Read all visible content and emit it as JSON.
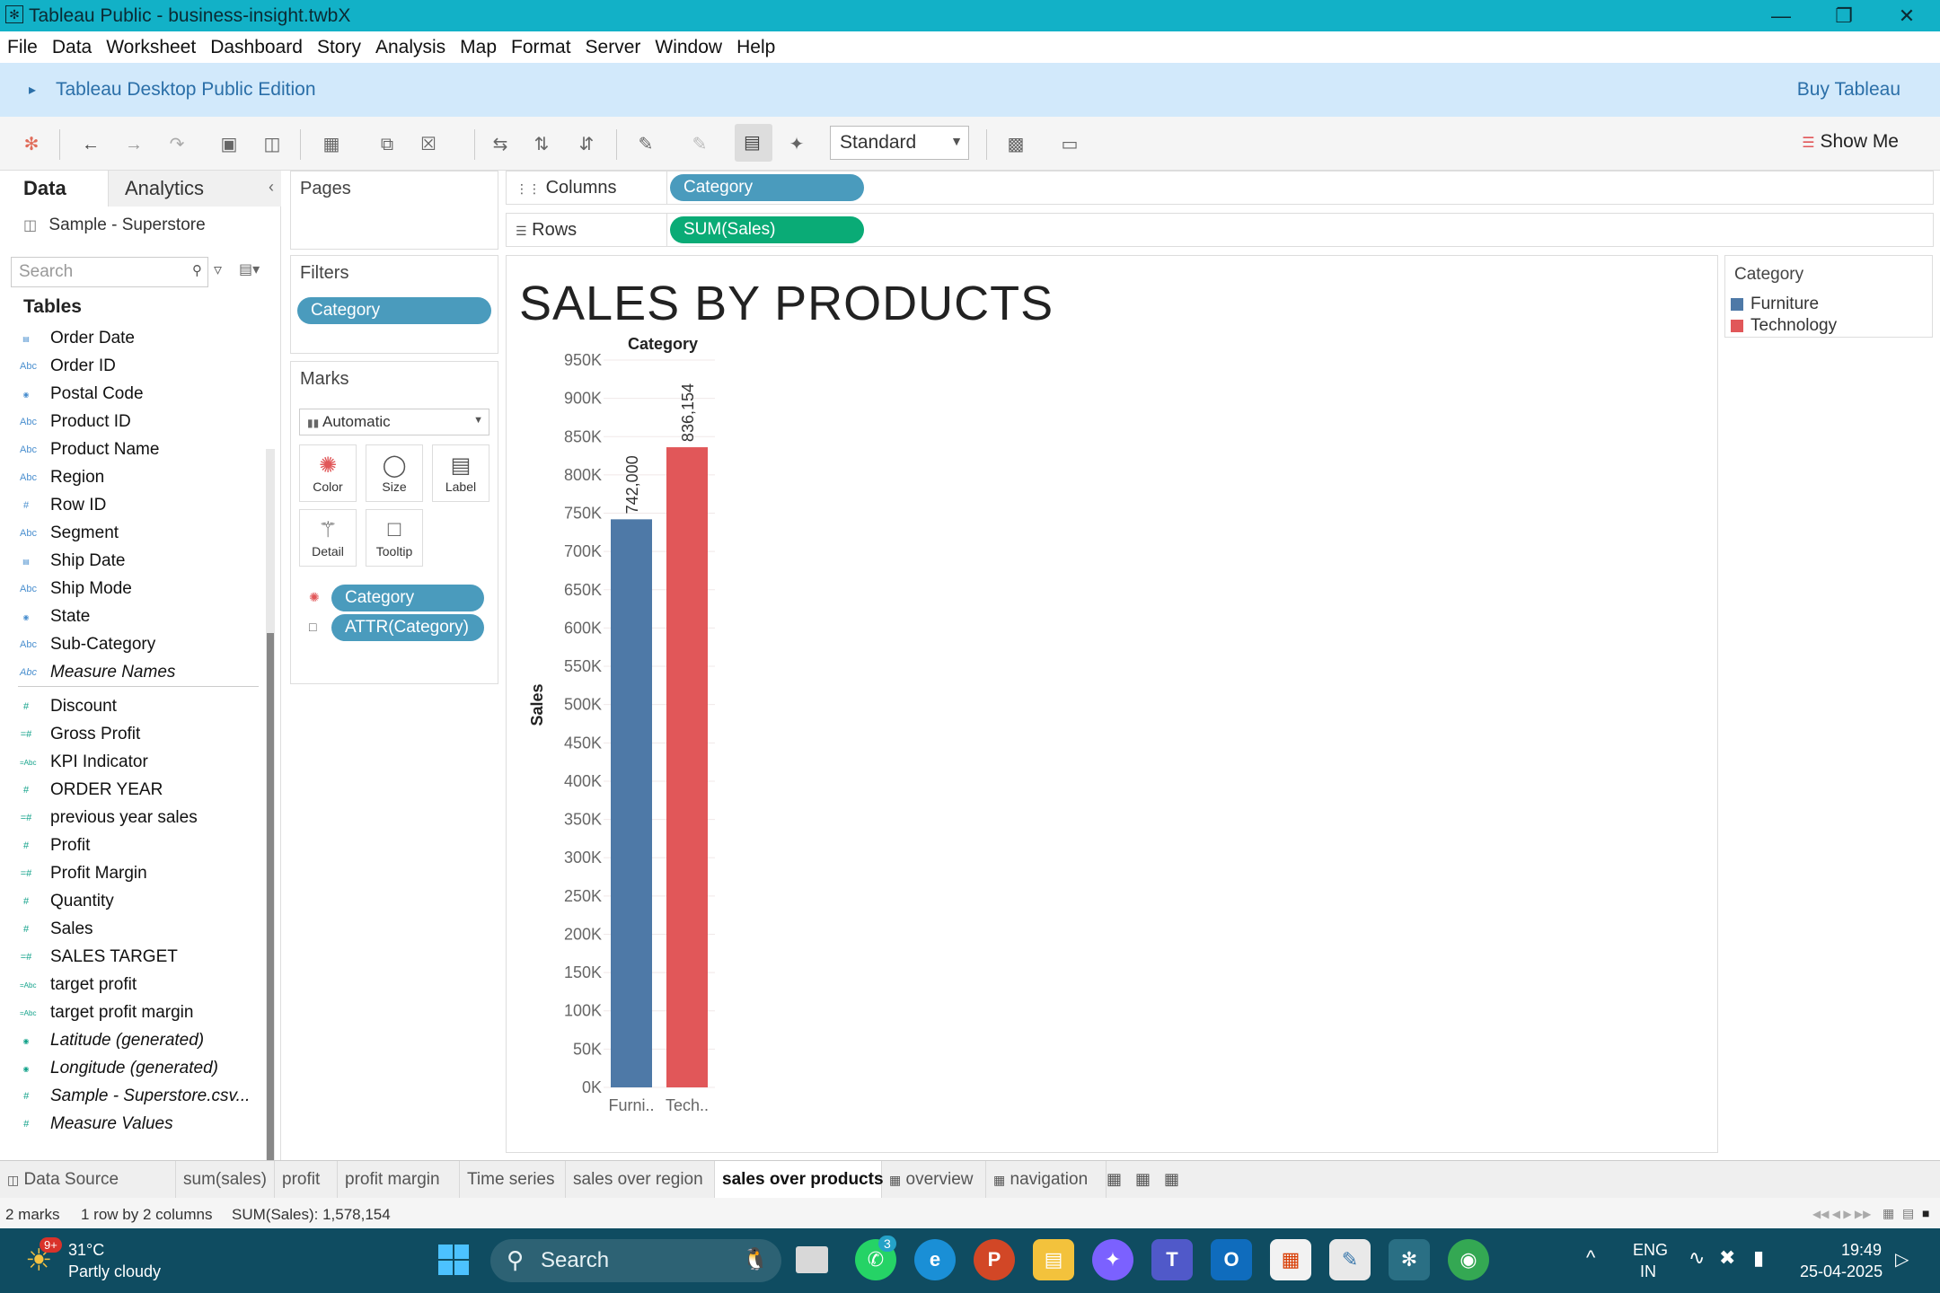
{
  "window": {
    "title": "Tableau Public - business-insight.twbX",
    "icon": "tableau-logo-icon",
    "controls": [
      "minimize-icon",
      "restore-icon",
      "close-icon"
    ]
  },
  "menu": [
    "File",
    "Data",
    "Worksheet",
    "Dashboard",
    "Story",
    "Analysis",
    "Map",
    "Format",
    "Server",
    "Window",
    "Help"
  ],
  "banner": {
    "edition": "Tableau Desktop Public Edition",
    "buy": "Buy Tableau"
  },
  "toolbar": {
    "fit_select": "Standard",
    "show_me": "Show Me"
  },
  "left_pane": {
    "tabs": [
      "Data",
      "Analytics"
    ],
    "datasource": "Sample - Superstore",
    "search_placeholder": "Search",
    "tables_heading": "Tables",
    "dimensions": [
      {
        "name": "Order Date",
        "type": "date"
      },
      {
        "name": "Order ID",
        "type": "abc"
      },
      {
        "name": "Postal Code",
        "type": "geo"
      },
      {
        "name": "Product ID",
        "type": "abc"
      },
      {
        "name": "Product Name",
        "type": "abc"
      },
      {
        "name": "Region",
        "type": "abc"
      },
      {
        "name": "Row ID",
        "type": "num"
      },
      {
        "name": "Segment",
        "type": "abc"
      },
      {
        "name": "Ship Date",
        "type": "date"
      },
      {
        "name": "Ship Mode",
        "type": "abc"
      },
      {
        "name": "State",
        "type": "geo"
      },
      {
        "name": "Sub-Category",
        "type": "abc"
      },
      {
        "name": "Measure Names",
        "type": "abc",
        "italic": true
      }
    ],
    "measures": [
      {
        "name": "Discount",
        "type": "num"
      },
      {
        "name": "Gross Profit",
        "type": "calc"
      },
      {
        "name": "KPI Indicator",
        "type": "calcabc"
      },
      {
        "name": "ORDER YEAR",
        "type": "num"
      },
      {
        "name": "previous year sales",
        "type": "calc"
      },
      {
        "name": "Profit",
        "type": "num"
      },
      {
        "name": "Profit Margin",
        "type": "calc"
      },
      {
        "name": "Quantity",
        "type": "num"
      },
      {
        "name": "Sales",
        "type": "num"
      },
      {
        "name": "SALES TARGET",
        "type": "calc"
      },
      {
        "name": "target profit",
        "type": "calcabc"
      },
      {
        "name": "target profit margin",
        "type": "calcabc"
      },
      {
        "name": "Latitude (generated)",
        "type": "geo",
        "italic": true
      },
      {
        "name": "Longitude (generated)",
        "type": "geo",
        "italic": true
      },
      {
        "name": "Sample - Superstore.csv...",
        "type": "num",
        "italic": true
      },
      {
        "name": "Measure Values",
        "type": "num",
        "italic": true
      }
    ]
  },
  "pages_title": "Pages",
  "filters": {
    "title": "Filters",
    "pill": "Category"
  },
  "marks": {
    "title": "Marks",
    "type": "Automatic",
    "buttons": [
      "Color",
      "Size",
      "Label",
      "Detail",
      "Tooltip"
    ],
    "pills": [
      "Category",
      "ATTR(Category)"
    ]
  },
  "columns": {
    "label": "Columns",
    "pill": "Category"
  },
  "rows": {
    "label": "Rows",
    "pill": "SUM(Sales)"
  },
  "viz": {
    "title": "SALES BY PRODUCTS"
  },
  "legend": {
    "title": "Category",
    "items": [
      {
        "label": "Furniture",
        "color": "#4e79a7"
      },
      {
        "label": "Technology",
        "color": "#e15759"
      }
    ]
  },
  "chart_data": {
    "type": "bar",
    "title": "SALES BY PRODUCTS",
    "header": "Category",
    "categories": [
      "Furni..",
      "Tech.."
    ],
    "values": [
      742000,
      836154
    ],
    "value_labels": [
      "742,000",
      "836,154"
    ],
    "colors": [
      "#4e79a7",
      "#e15759"
    ],
    "ylabel": "Sales",
    "ylim": [
      0,
      950000
    ],
    "yticks": [
      0,
      50000,
      100000,
      150000,
      200000,
      250000,
      300000,
      350000,
      400000,
      450000,
      500000,
      550000,
      600000,
      650000,
      700000,
      750000,
      800000,
      850000,
      900000,
      950000
    ],
    "ytick_labels": [
      "0K",
      "50K",
      "100K",
      "150K",
      "200K",
      "250K",
      "300K",
      "350K",
      "400K",
      "450K",
      "500K",
      "550K",
      "600K",
      "650K",
      "700K",
      "750K",
      "800K",
      "850K",
      "900K",
      "950K"
    ]
  },
  "sheet_tabs": [
    {
      "label": "Data Source",
      "icon": "database-icon"
    },
    {
      "label": "sum(sales)"
    },
    {
      "label": "profit"
    },
    {
      "label": "profit margin"
    },
    {
      "label": "Time series"
    },
    {
      "label": "sales over region"
    },
    {
      "label": "sales over products",
      "active": true
    },
    {
      "label": "overview",
      "icon": "dashboard-icon"
    },
    {
      "label": "navigation",
      "icon": "dashboard-icon"
    }
  ],
  "status": {
    "marks": "2 marks",
    "dims": "1 row by 2 columns",
    "sum": "SUM(Sales): 1,578,154"
  },
  "taskbar": {
    "weather_temp": "31°C",
    "weather_desc": "Partly cloudy",
    "weather_badge": "9+",
    "search": "Search",
    "whatsapp_badge": "3",
    "lang_top": "ENG",
    "lang_bottom": "IN",
    "time": "19:49",
    "date": "25-04-2025"
  }
}
